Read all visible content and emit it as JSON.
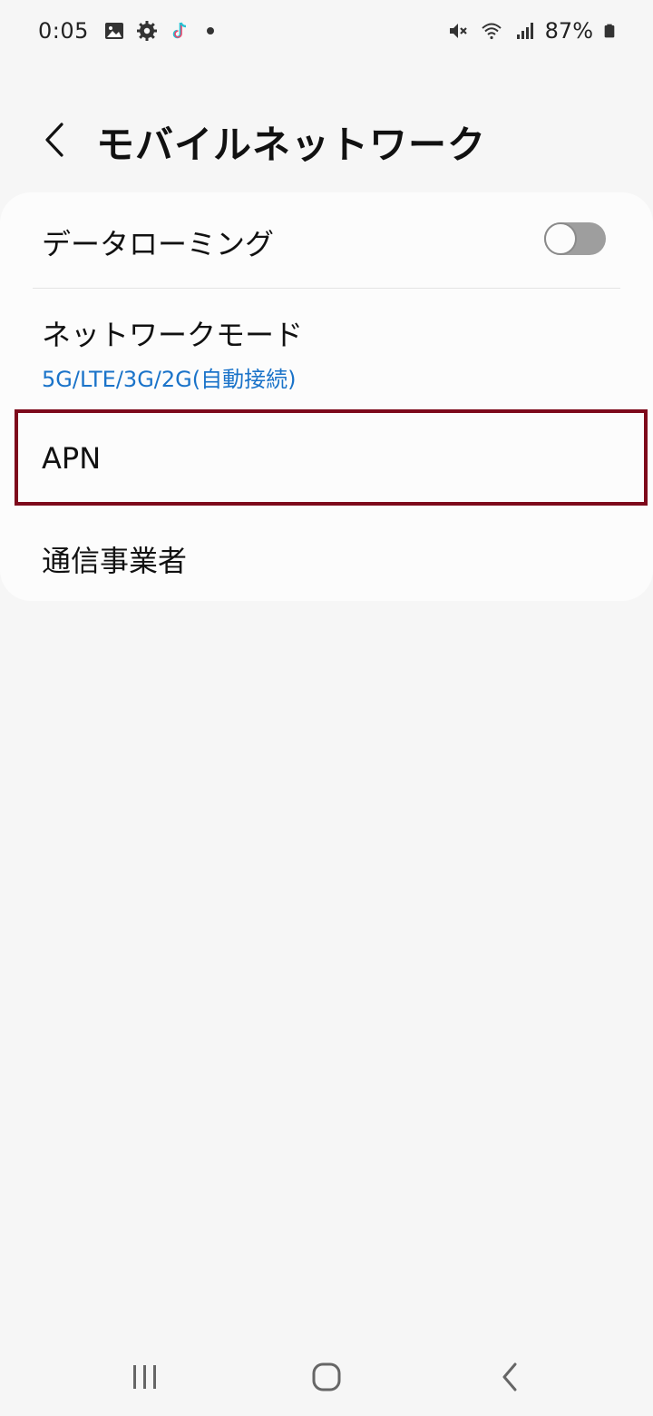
{
  "status_bar": {
    "time": "0:05",
    "battery_percent": "87%",
    "icons_left": [
      "gallery-icon",
      "settings-gear-icon",
      "tiktok-icon",
      "notification-dot"
    ],
    "icons_right": [
      "mute-icon",
      "wifi-icon",
      "signal-icon",
      "battery-icon"
    ]
  },
  "header": {
    "title": "モバイルネットワーク"
  },
  "settings": {
    "data_roaming": {
      "label": "データローミング",
      "toggle_on": false
    },
    "network_mode": {
      "label": "ネットワークモード",
      "value": "5G/LTE/3G/2G(自動接続)"
    },
    "apn": {
      "label": "APN"
    },
    "carrier": {
      "label": "通信事業者"
    }
  },
  "colors": {
    "accent_blue": "#1a73c9",
    "highlight_border": "#7d0a1b",
    "background": "#f6f6f6",
    "card": "#fcfcfc"
  },
  "nav_bar": {
    "items": [
      "recents-icon",
      "home-icon",
      "back-icon"
    ]
  }
}
